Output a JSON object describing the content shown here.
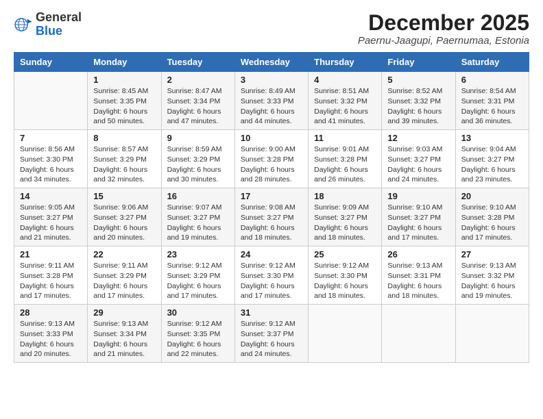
{
  "logo": {
    "general": "General",
    "blue": "Blue"
  },
  "title": "December 2025",
  "subtitle": "Paernu-Jaagupi, Paernumaa, Estonia",
  "days_header": [
    "Sunday",
    "Monday",
    "Tuesday",
    "Wednesday",
    "Thursday",
    "Friday",
    "Saturday"
  ],
  "weeks": [
    [
      {
        "day": "",
        "info": ""
      },
      {
        "day": "1",
        "info": "Sunrise: 8:45 AM\nSunset: 3:35 PM\nDaylight: 6 hours\nand 50 minutes."
      },
      {
        "day": "2",
        "info": "Sunrise: 8:47 AM\nSunset: 3:34 PM\nDaylight: 6 hours\nand 47 minutes."
      },
      {
        "day": "3",
        "info": "Sunrise: 8:49 AM\nSunset: 3:33 PM\nDaylight: 6 hours\nand 44 minutes."
      },
      {
        "day": "4",
        "info": "Sunrise: 8:51 AM\nSunset: 3:32 PM\nDaylight: 6 hours\nand 41 minutes."
      },
      {
        "day": "5",
        "info": "Sunrise: 8:52 AM\nSunset: 3:32 PM\nDaylight: 6 hours\nand 39 minutes."
      },
      {
        "day": "6",
        "info": "Sunrise: 8:54 AM\nSunset: 3:31 PM\nDaylight: 6 hours\nand 36 minutes."
      }
    ],
    [
      {
        "day": "7",
        "info": "Sunrise: 8:56 AM\nSunset: 3:30 PM\nDaylight: 6 hours\nand 34 minutes."
      },
      {
        "day": "8",
        "info": "Sunrise: 8:57 AM\nSunset: 3:29 PM\nDaylight: 6 hours\nand 32 minutes."
      },
      {
        "day": "9",
        "info": "Sunrise: 8:59 AM\nSunset: 3:29 PM\nDaylight: 6 hours\nand 30 minutes."
      },
      {
        "day": "10",
        "info": "Sunrise: 9:00 AM\nSunset: 3:28 PM\nDaylight: 6 hours\nand 28 minutes."
      },
      {
        "day": "11",
        "info": "Sunrise: 9:01 AM\nSunset: 3:28 PM\nDaylight: 6 hours\nand 26 minutes."
      },
      {
        "day": "12",
        "info": "Sunrise: 9:03 AM\nSunset: 3:27 PM\nDaylight: 6 hours\nand 24 minutes."
      },
      {
        "day": "13",
        "info": "Sunrise: 9:04 AM\nSunset: 3:27 PM\nDaylight: 6 hours\nand 23 minutes."
      }
    ],
    [
      {
        "day": "14",
        "info": "Sunrise: 9:05 AM\nSunset: 3:27 PM\nDaylight: 6 hours\nand 21 minutes."
      },
      {
        "day": "15",
        "info": "Sunrise: 9:06 AM\nSunset: 3:27 PM\nDaylight: 6 hours\nand 20 minutes."
      },
      {
        "day": "16",
        "info": "Sunrise: 9:07 AM\nSunset: 3:27 PM\nDaylight: 6 hours\nand 19 minutes."
      },
      {
        "day": "17",
        "info": "Sunrise: 9:08 AM\nSunset: 3:27 PM\nDaylight: 6 hours\nand 18 minutes."
      },
      {
        "day": "18",
        "info": "Sunrise: 9:09 AM\nSunset: 3:27 PM\nDaylight: 6 hours\nand 18 minutes."
      },
      {
        "day": "19",
        "info": "Sunrise: 9:10 AM\nSunset: 3:27 PM\nDaylight: 6 hours\nand 17 minutes."
      },
      {
        "day": "20",
        "info": "Sunrise: 9:10 AM\nSunset: 3:28 PM\nDaylight: 6 hours\nand 17 minutes."
      }
    ],
    [
      {
        "day": "21",
        "info": "Sunrise: 9:11 AM\nSunset: 3:28 PM\nDaylight: 6 hours\nand 17 minutes."
      },
      {
        "day": "22",
        "info": "Sunrise: 9:11 AM\nSunset: 3:29 PM\nDaylight: 6 hours\nand 17 minutes."
      },
      {
        "day": "23",
        "info": "Sunrise: 9:12 AM\nSunset: 3:29 PM\nDaylight: 6 hours\nand 17 minutes."
      },
      {
        "day": "24",
        "info": "Sunrise: 9:12 AM\nSunset: 3:30 PM\nDaylight: 6 hours\nand 17 minutes."
      },
      {
        "day": "25",
        "info": "Sunrise: 9:12 AM\nSunset: 3:30 PM\nDaylight: 6 hours\nand 18 minutes."
      },
      {
        "day": "26",
        "info": "Sunrise: 9:13 AM\nSunset: 3:31 PM\nDaylight: 6 hours\nand 18 minutes."
      },
      {
        "day": "27",
        "info": "Sunrise: 9:13 AM\nSunset: 3:32 PM\nDaylight: 6 hours\nand 19 minutes."
      }
    ],
    [
      {
        "day": "28",
        "info": "Sunrise: 9:13 AM\nSunset: 3:33 PM\nDaylight: 6 hours\nand 20 minutes."
      },
      {
        "day": "29",
        "info": "Sunrise: 9:13 AM\nSunset: 3:34 PM\nDaylight: 6 hours\nand 21 minutes."
      },
      {
        "day": "30",
        "info": "Sunrise: 9:12 AM\nSunset: 3:35 PM\nDaylight: 6 hours\nand 22 minutes."
      },
      {
        "day": "31",
        "info": "Sunrise: 9:12 AM\nSunset: 3:37 PM\nDaylight: 6 hours\nand 24 minutes."
      },
      {
        "day": "",
        "info": ""
      },
      {
        "day": "",
        "info": ""
      },
      {
        "day": "",
        "info": ""
      }
    ]
  ]
}
